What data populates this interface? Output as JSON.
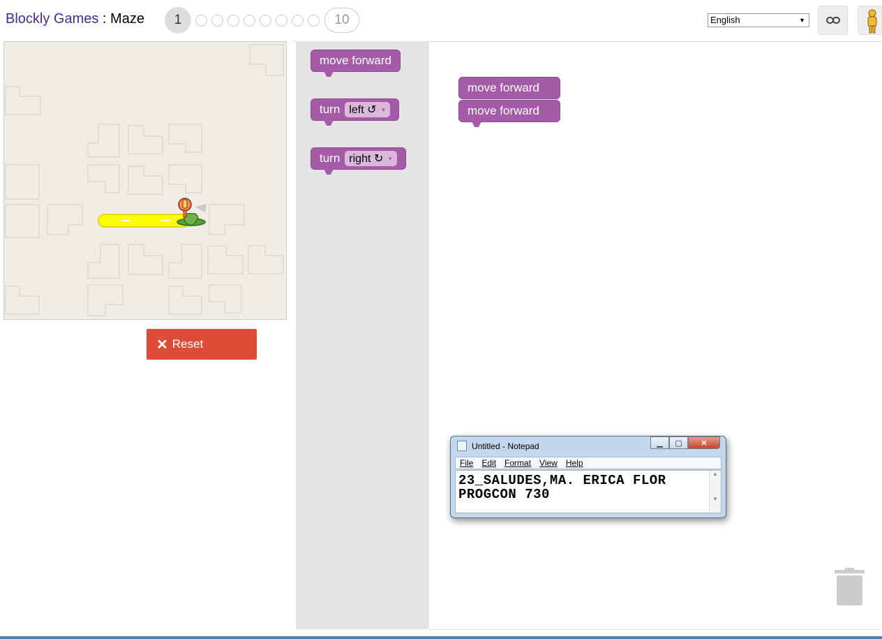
{
  "header": {
    "brand": "Blockly Games",
    "separator": " : ",
    "game": "Maze",
    "levels": {
      "current": "1",
      "last": "10",
      "dots_count": 8
    },
    "language": "English"
  },
  "maze": {
    "reset_label": "Reset",
    "colors": {
      "path": "#ffff00",
      "background": "#f0ede6"
    }
  },
  "toolbox": {
    "blocks": [
      {
        "text": "move forward"
      },
      {
        "text": "turn",
        "dropdown": "left ↺"
      },
      {
        "text": "turn",
        "dropdown": "right ↻"
      }
    ]
  },
  "workspace": {
    "program": [
      "move forward",
      "move forward"
    ]
  },
  "notepad": {
    "title": "Untitled - Notepad",
    "menu": [
      "File",
      "Edit",
      "Format",
      "View",
      "Help"
    ],
    "line1": "23_SALUDES,MA. ERICA FLOR",
    "line2": "PROGCON 730"
  },
  "colors": {
    "block": "#a55ba8",
    "reset": "#dd4b39",
    "brand": "#4a2a8a"
  }
}
